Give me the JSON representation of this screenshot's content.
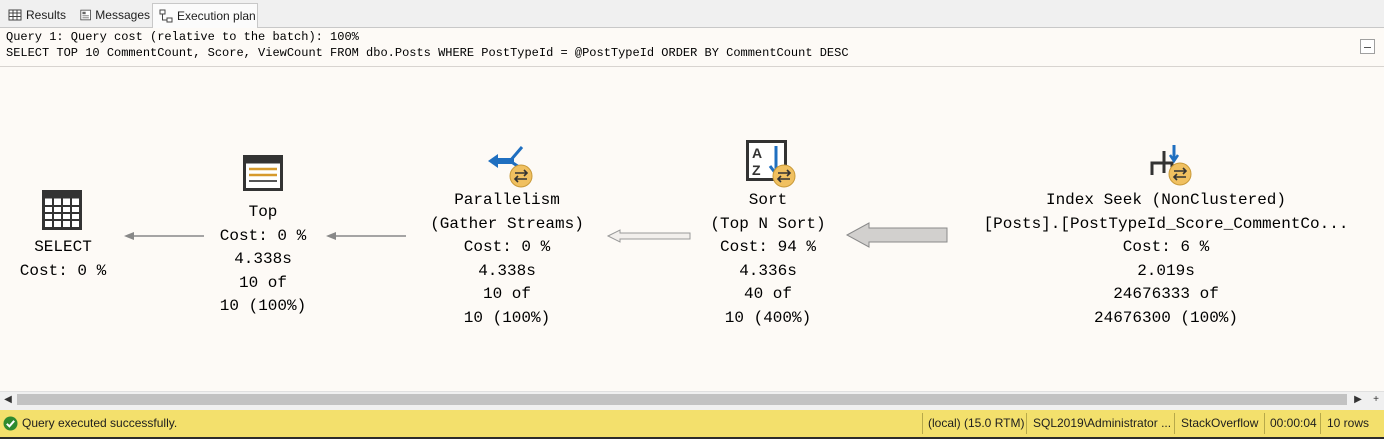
{
  "tabs": [
    {
      "label": "Results",
      "icon": "grid-icon"
    },
    {
      "label": "Messages",
      "icon": "messages-icon"
    },
    {
      "label": "Execution plan",
      "icon": "execution-plan-icon"
    }
  ],
  "query_header": {
    "line1": "Query 1: Query cost (relative to the batch): 100%",
    "line2": "SELECT TOP 10 CommentCount, Score, ViewCount FROM dbo.Posts WHERE PostTypeId = @PostTypeId ORDER BY CommentCount DESC"
  },
  "operators": {
    "select": {
      "name": "SELECT",
      "cost": "Cost: 0 %"
    },
    "top": {
      "name": "Top",
      "cost": "Cost: 0 %",
      "time": "4.338s",
      "rows_actual": "10 of",
      "rows_estimate": "10 (100%)"
    },
    "parallelism": {
      "name": "Parallelism",
      "subtitle": "(Gather Streams)",
      "cost": "Cost: 0 %",
      "time": "4.338s",
      "rows_actual": "10 of",
      "rows_estimate": "10 (100%)"
    },
    "sort": {
      "name": "Sort",
      "subtitle": "(Top N Sort)",
      "cost": "Cost: 94 %",
      "time": "4.336s",
      "rows_actual": "40 of",
      "rows_estimate": "10 (400%)"
    },
    "index_seek": {
      "name": "Index Seek (NonClustered)",
      "subtitle": "[Posts].[PostTypeId_Score_CommentCo...",
      "cost": "Cost: 6 %",
      "time": "2.019s",
      "rows_actual": "24676333 of",
      "rows_estimate": "24676300 (100%)"
    }
  },
  "status_bar": {
    "message": "Query executed successfully.",
    "server": "(local) (15.0 RTM)",
    "login": "SQL2019\\Administrator ...",
    "database": "StackOverflow",
    "elapsed": "00:00:04",
    "rows": "10 rows"
  },
  "colors": {
    "status_bar": "#f3e06c",
    "plan_background": "#fdfaf6",
    "parallel_badge": "#f0c060",
    "icon_blue": "#1f6fc0"
  }
}
